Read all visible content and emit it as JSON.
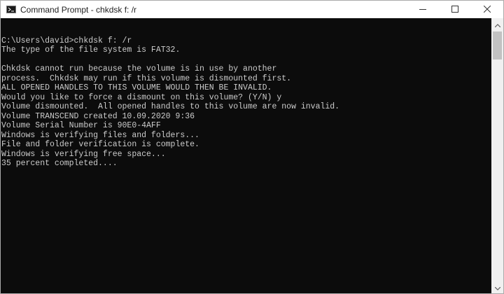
{
  "window": {
    "title": "Command Prompt - chkdsk  f: /r"
  },
  "console": {
    "lines": [
      "",
      "C:\\Users\\david>chkdsk f: /r",
      "The type of the file system is FAT32.",
      "",
      "Chkdsk cannot run because the volume is in use by another",
      "process.  Chkdsk may run if this volume is dismounted first.",
      "ALL OPENED HANDLES TO THIS VOLUME WOULD THEN BE INVALID.",
      "Would you like to force a dismount on this volume? (Y/N) y",
      "Volume dismounted.  All opened handles to this volume are now invalid.",
      "Volume TRANSCEND created 10.09.2020 9:36",
      "Volume Serial Number is 90E0-4AFF",
      "Windows is verifying files and folders...",
      "File and folder verification is complete.",
      "Windows is verifying free space...",
      "35 percent completed...."
    ]
  },
  "colors": {
    "console_bg": "#0c0c0c",
    "console_text": "#cccccc",
    "titlebar_bg": "#ffffff"
  },
  "icons": {
    "app": "cmd-icon",
    "minimize": "minimize-icon",
    "maximize": "maximize-icon",
    "close": "close-icon"
  }
}
